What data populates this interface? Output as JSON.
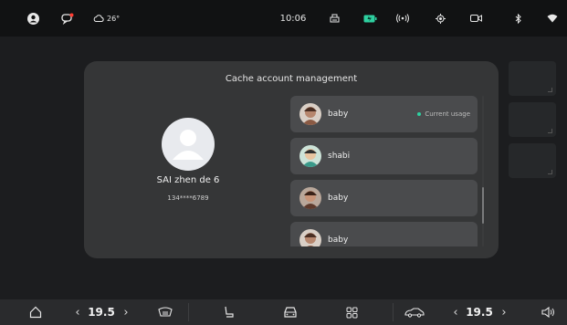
{
  "status_bar": {
    "weather": "26°",
    "time": "10:06",
    "icons": [
      "user-icon",
      "chat-icon",
      "cloud-icon",
      "printer-icon",
      "battery-icon",
      "broadcast-icon",
      "location-icon",
      "camera-icon",
      "bluetooth-icon",
      "wifi-icon"
    ]
  },
  "dialog": {
    "title": "Cache account management",
    "current_user": {
      "name": "SAI zhen de 6",
      "phone": "134****6789"
    },
    "accounts": [
      {
        "name": "baby",
        "status": "Current usage",
        "avatar_color": "#b7876e"
      },
      {
        "name": "shabi",
        "status": "",
        "avatar_color": "#3a9a8a"
      },
      {
        "name": "baby",
        "status": "",
        "avatar_color": "#8c5a44"
      },
      {
        "name": "baby",
        "status": "",
        "avatar_color": "#b7876e"
      }
    ]
  },
  "dock": {
    "left_temp": "19.5",
    "right_temp": "19.5",
    "left_arrow": "‹",
    "right_arrow": "›",
    "icons": [
      "home-icon",
      "defrost-icon",
      "seat-icon",
      "car-icon",
      "apps-icon",
      "car-side-icon",
      "volume-icon"
    ]
  },
  "colors": {
    "accent": "#2ed0a0",
    "dialog_bg": "#353637",
    "row_bg": "#4a4b4d"
  }
}
